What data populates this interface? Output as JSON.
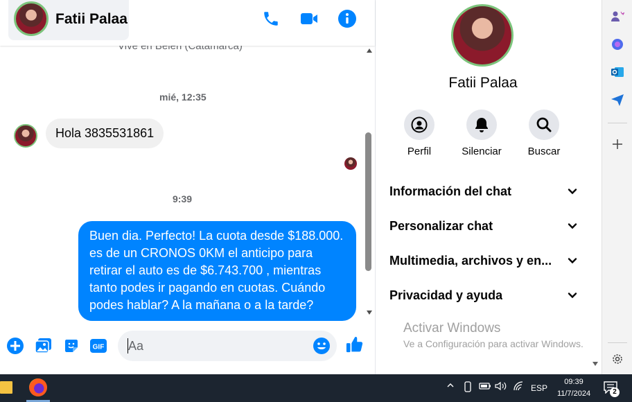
{
  "header": {
    "contact_name": "Fatii Palaa"
  },
  "conversation": {
    "previous_text": "Vive en Belén (Catamarca)",
    "timestamp_1": "mié, 12:35",
    "incoming_message": "Hola 3835531861",
    "timestamp_2": "9:39",
    "outgoing_message": "Buen dia. Perfecto! La cuota desde $188.000. es de un CRONOS 0KM el anticipo para retirar el auto es de $6.743.700 , mientras tanto podes ir pagando en cuotas. Cuándo podes hablar? A la mañana o a la tarde?"
  },
  "composer": {
    "placeholder": "Aa",
    "gif_label": "GIF"
  },
  "info_panel": {
    "name": "Fatii Palaa",
    "actions": [
      {
        "label": "Perfil",
        "icon": "profile-icon"
      },
      {
        "label": "Silenciar",
        "icon": "bell-icon"
      },
      {
        "label": "Buscar",
        "icon": "search-icon"
      }
    ],
    "sections": [
      {
        "label": "Información del chat"
      },
      {
        "label": "Personalizar chat"
      },
      {
        "label": "Multimedia, archivos y en..."
      },
      {
        "label": "Privacidad y ayuda"
      }
    ]
  },
  "watermark": {
    "title": "Activar Windows",
    "subtitle": "Ve a Configuración para activar Windows."
  },
  "taskbar": {
    "language": "ESP",
    "time": "09:39",
    "date": "11/7/2024",
    "notification_count": "2"
  },
  "colors": {
    "accent": "#0084ff",
    "bubble_in": "#f0f0f0",
    "taskbar": "#1c2530"
  }
}
